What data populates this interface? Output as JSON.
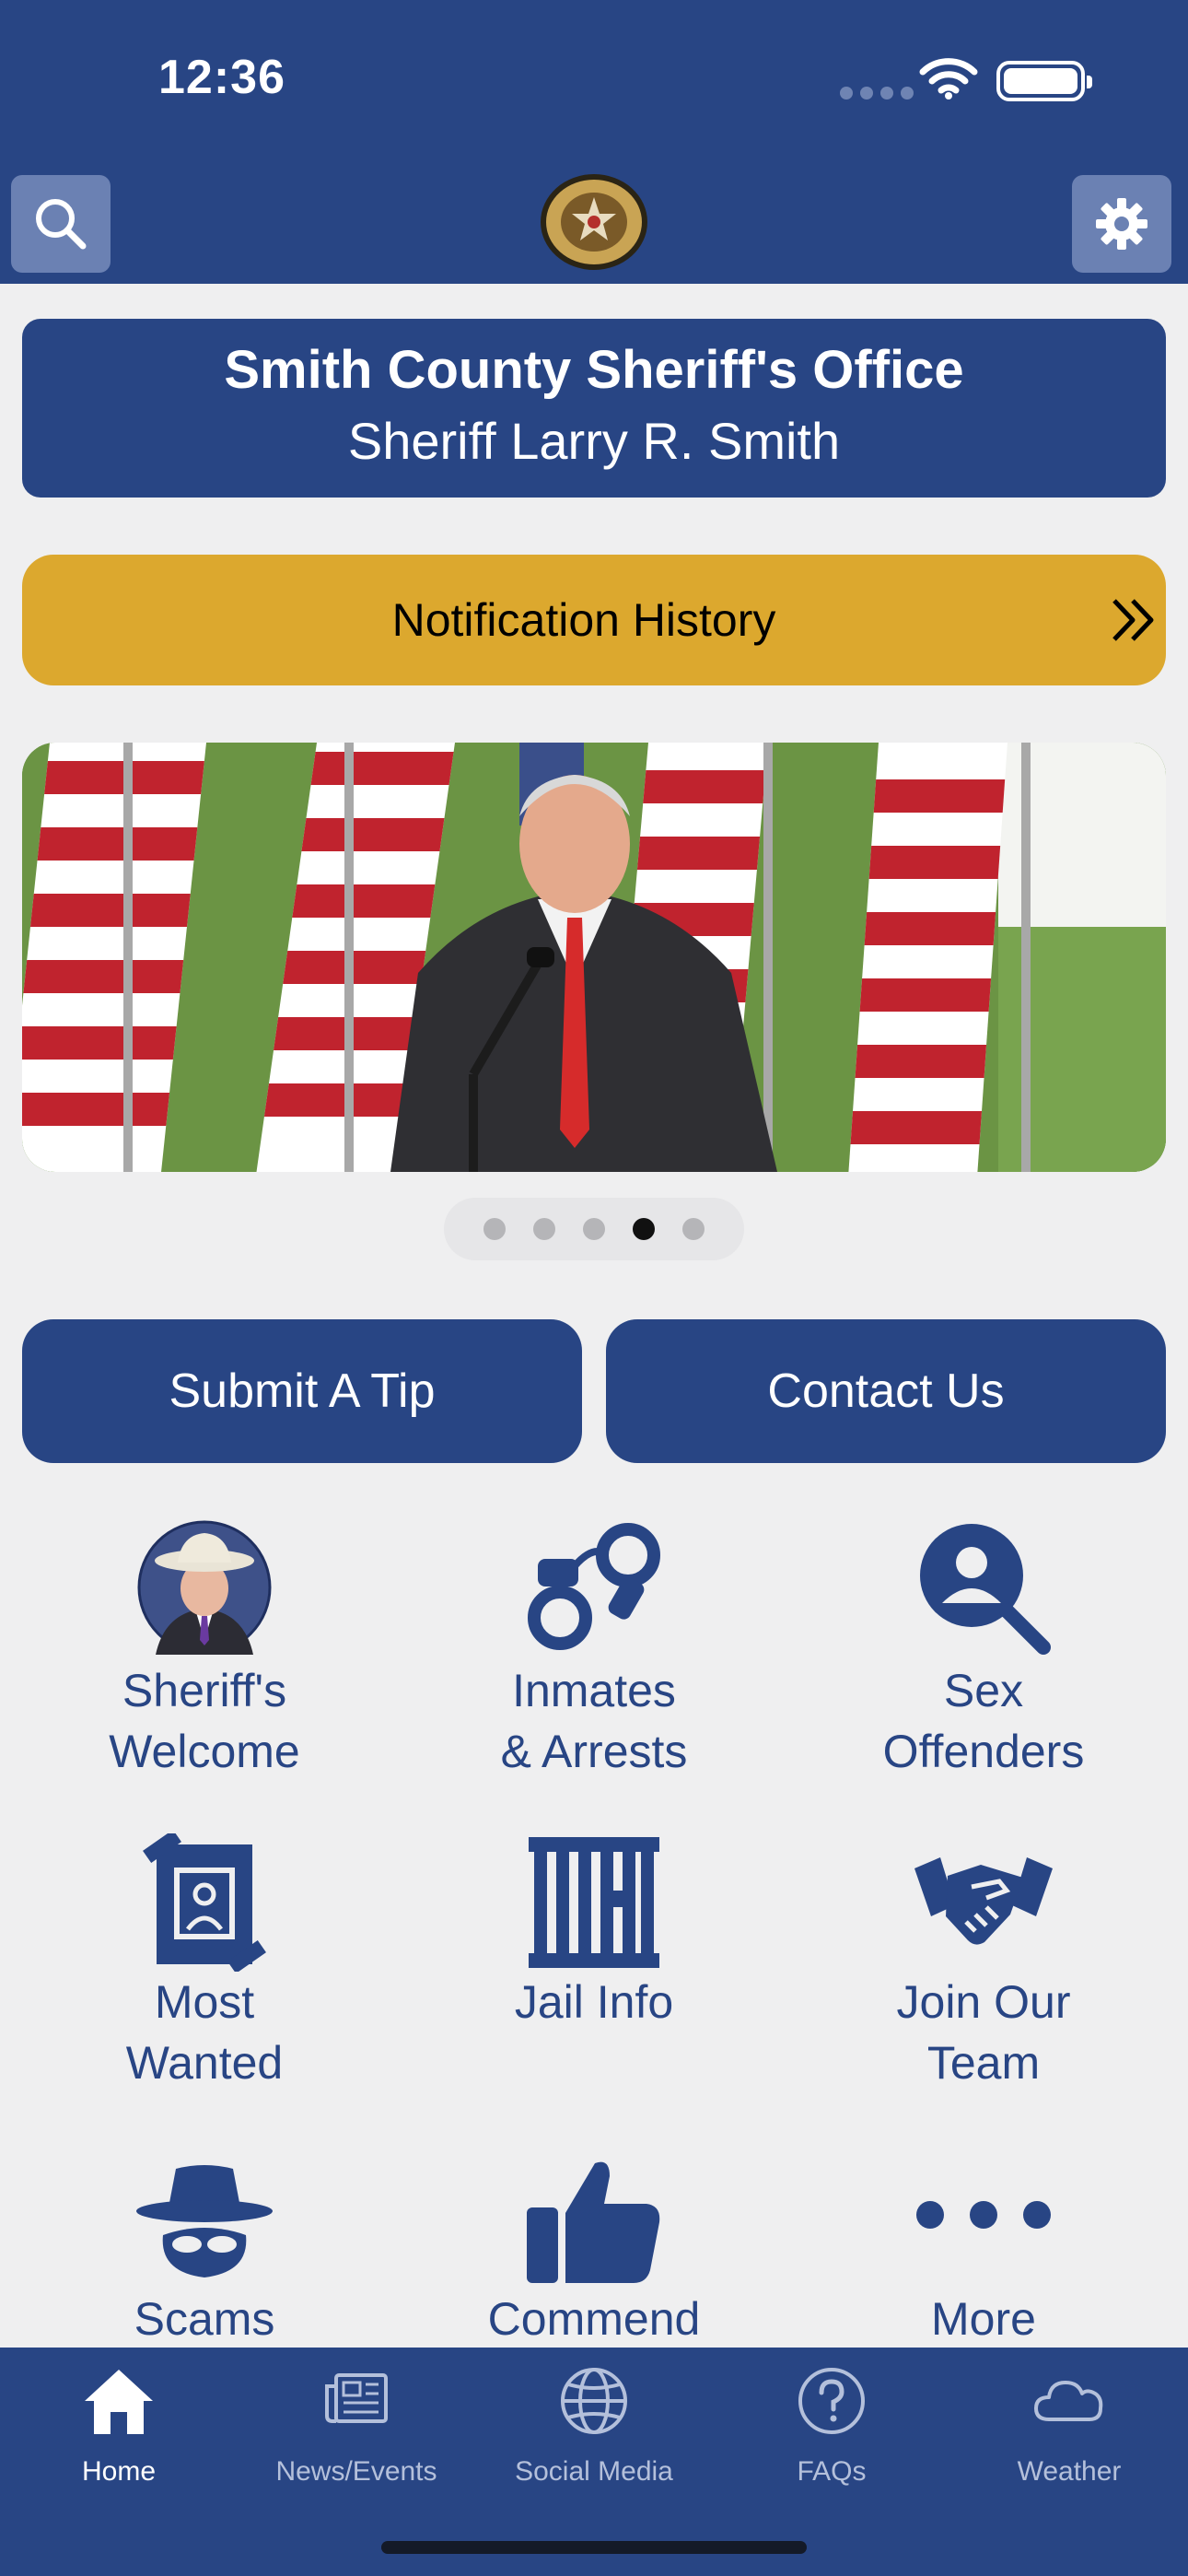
{
  "status_bar": {
    "time": "12:36"
  },
  "header": {
    "search_icon": "search-icon",
    "settings_icon": "gear-icon",
    "logo": "sheriff-badge-logo"
  },
  "title_card": {
    "office": "Smith County Sheriff's Office",
    "sheriff": "Sheriff Larry R. Smith"
  },
  "notification": {
    "label": "Notification History",
    "icon": "double-chevron-right-icon"
  },
  "carousel": {
    "slide_count": 5,
    "active_index": 3
  },
  "actions": {
    "submit_tip": "Submit A Tip",
    "contact_us": "Contact Us"
  },
  "grid": [
    {
      "line1": "Sheriff's",
      "line2": "Welcome",
      "icon": "sheriff-portrait"
    },
    {
      "line1": "Inmates",
      "line2": "& Arrests",
      "icon": "handcuffs-icon"
    },
    {
      "line1": "Sex",
      "line2": "Offenders",
      "icon": "person-search-icon"
    },
    {
      "line1": "Most",
      "line2": "Wanted",
      "icon": "wanted-poster-icon"
    },
    {
      "line1": "Jail Info",
      "line2": "",
      "icon": "jail-bars-icon"
    },
    {
      "line1": "Join Our",
      "line2": "Team",
      "icon": "handshake-icon"
    },
    {
      "line1": "Scams",
      "line2": "",
      "icon": "masked-bandit-icon"
    },
    {
      "line1": "Commend",
      "line2": "",
      "icon": "thumbs-up-icon"
    },
    {
      "line1": "More",
      "line2": "",
      "icon": "ellipsis-icon"
    }
  ],
  "tabs": [
    {
      "label": "Home",
      "icon": "home-icon",
      "active": true
    },
    {
      "label": "News/Events",
      "icon": "newspaper-icon"
    },
    {
      "label": "Social Media",
      "icon": "globe-icon"
    },
    {
      "label": "FAQs",
      "icon": "question-circle-icon"
    },
    {
      "label": "Weather",
      "icon": "cloud-icon"
    }
  ],
  "colors": {
    "primary": "#284584",
    "accent": "#dca82e",
    "background": "#efeff0"
  }
}
